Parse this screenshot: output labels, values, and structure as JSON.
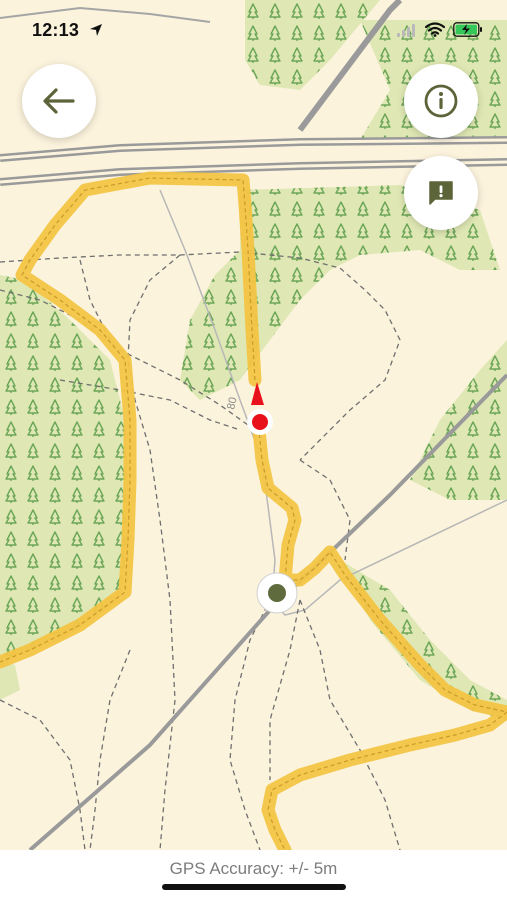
{
  "status_bar": {
    "time": "12:13",
    "location_services_icon": "location-arrow-icon",
    "signal_icon": "cellular-signal-icon",
    "wifi_icon": "wifi-icon",
    "battery_icon": "battery-charging-icon"
  },
  "controls": {
    "back_icon": "arrow-left-icon",
    "info_icon": "info-icon",
    "report_icon": "report-issue-icon"
  },
  "map": {
    "road_label": "80",
    "colors": {
      "background": "#fbf3dc",
      "woodland": "#dfe8b4",
      "tree_symbol": "#6ba557",
      "trail_highlight": "#f3c445",
      "road": "#9a9a9a",
      "path_dashed": "#6f6f6f",
      "current_location": "#e8101b",
      "waypoint": "#5f6b3c"
    }
  },
  "footer": {
    "gps_accuracy": "GPS Accuracy: +/- 5m"
  }
}
